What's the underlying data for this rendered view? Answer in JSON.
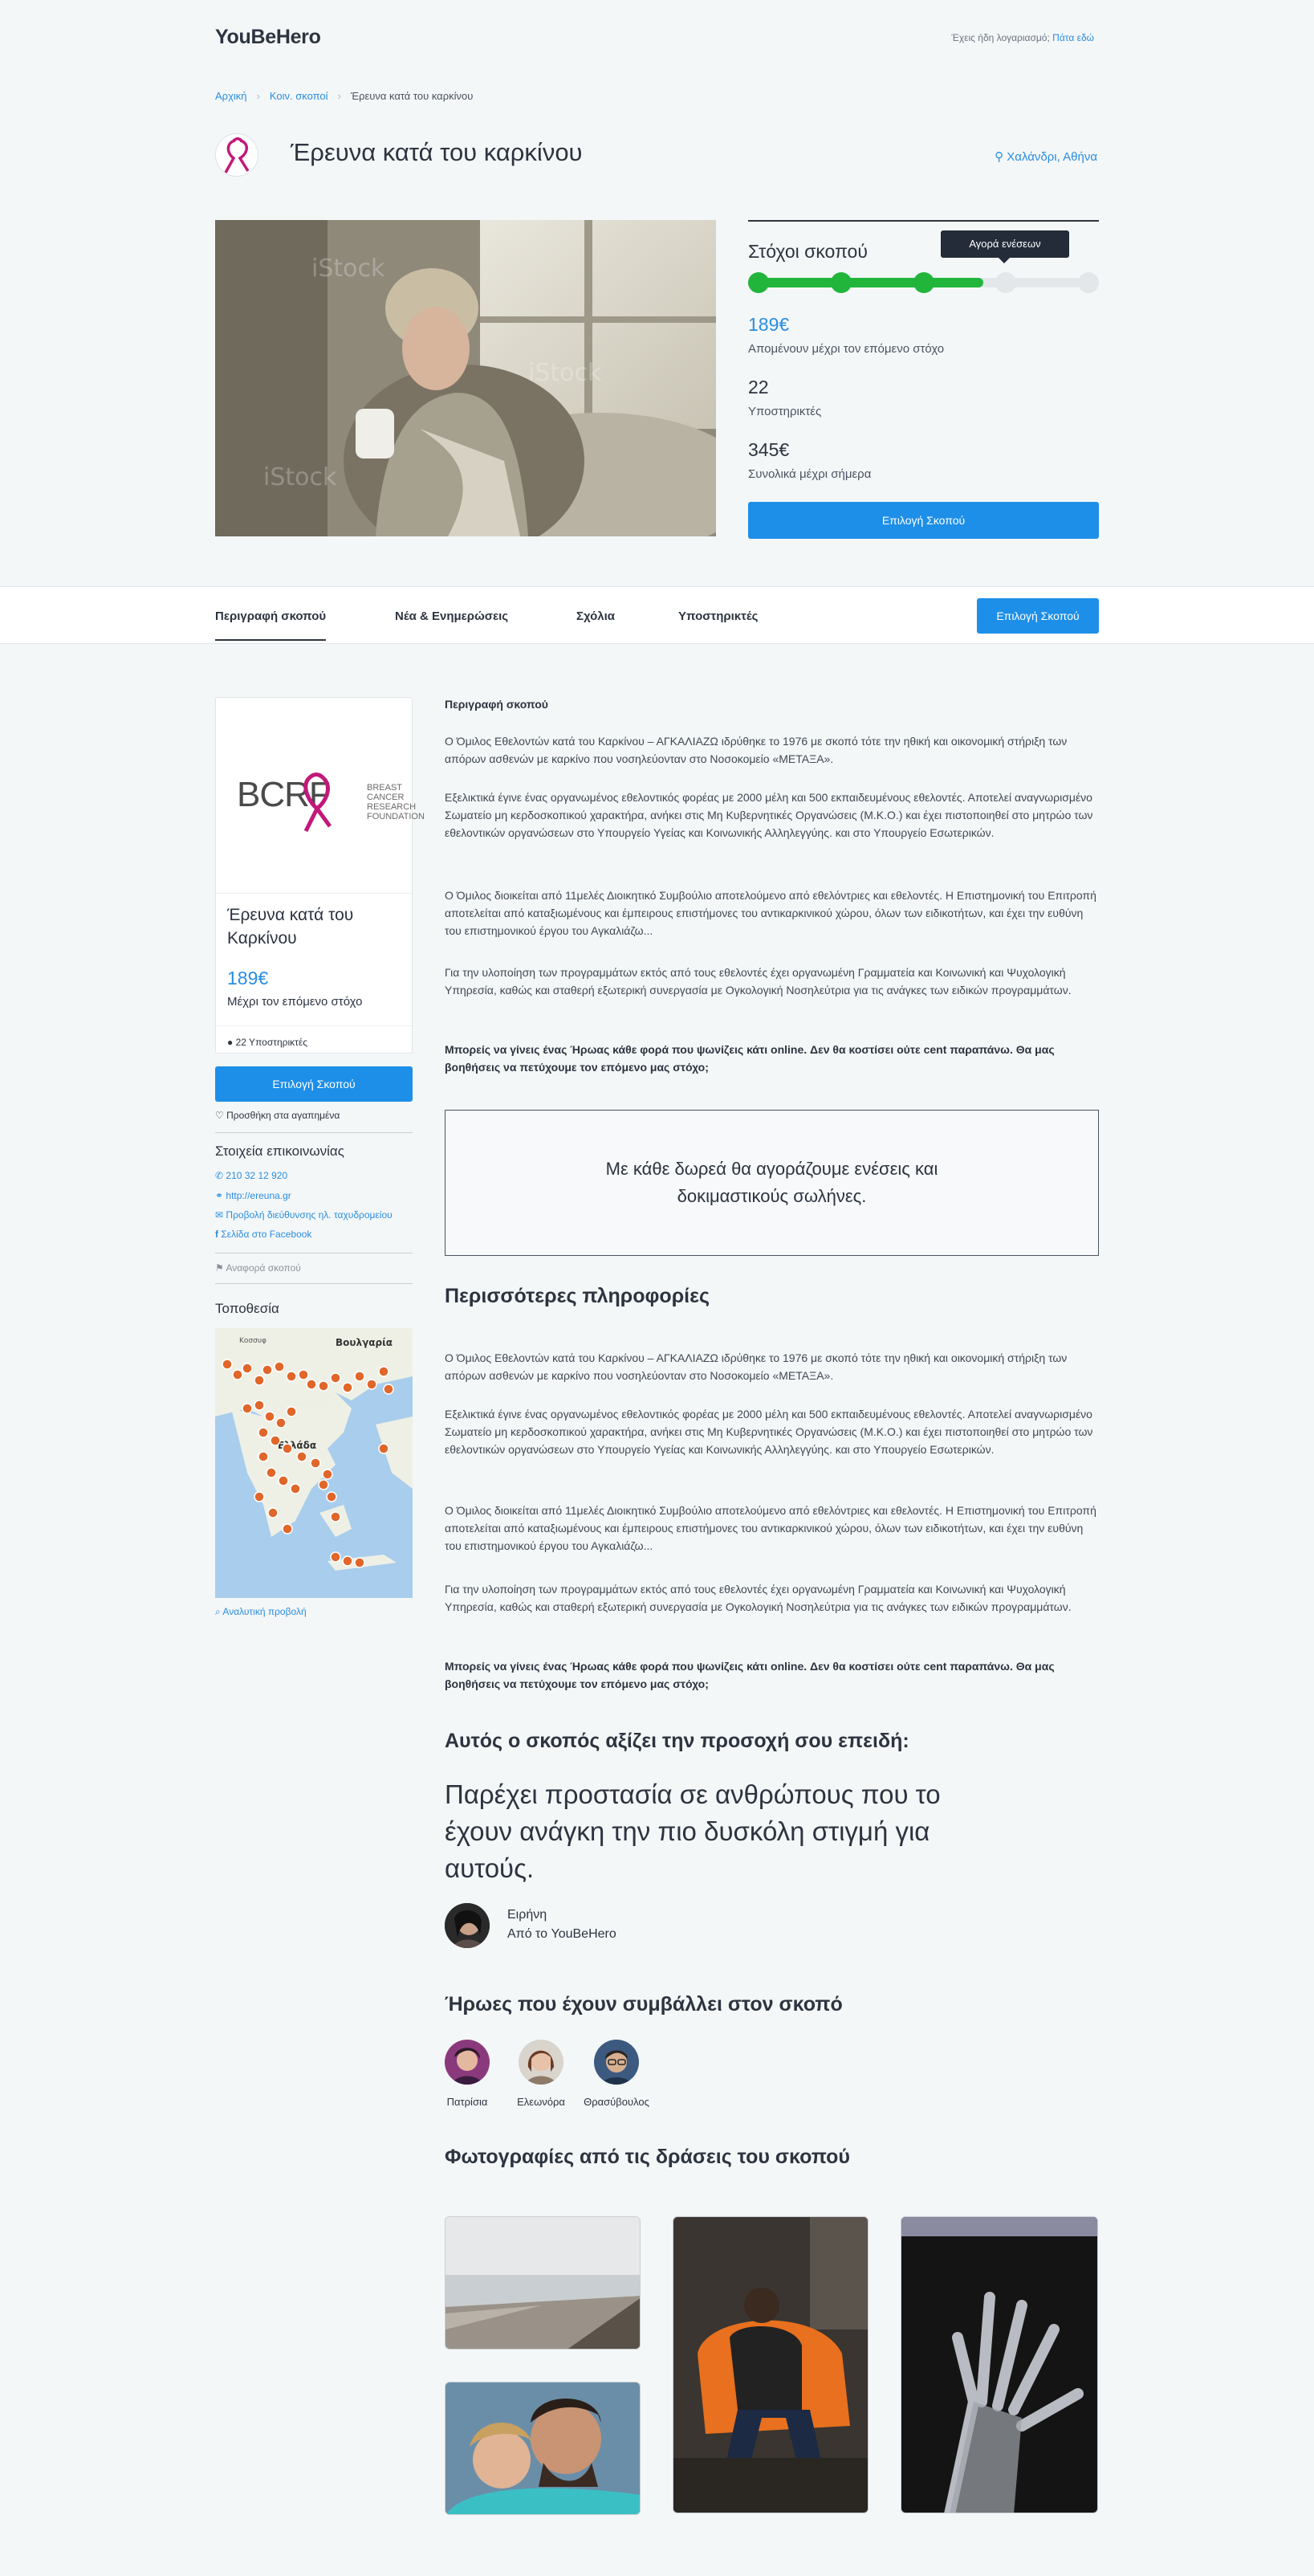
{
  "header": {
    "logo": "YouBeHero",
    "account_prompt": "Έχεις ήδη λογαριασμό;",
    "login_link": "Πάτα εδώ"
  },
  "breadcrumb": [
    "Αρχική",
    "Κοιν. σκοποί",
    "Έρευνα κατά του καρκίνου"
  ],
  "cause": {
    "title": "Έρευνα κατά του καρκίνου",
    "location": "Χαλάνδρι, Αθήνα"
  },
  "goals": {
    "title": "Στόχοι σκοπού",
    "tooltip": "Αγορά ενέσεων",
    "progress": 0.67,
    "milestones": 5,
    "milestones_reached": 3,
    "remaining_value": "189€",
    "remaining_label": "Απομένουν μέχρι τον επόμενο στόχο",
    "supporters_value": "22",
    "supporters_label": "Υποστηρικτές",
    "total_value": "345€",
    "total_label": "Συνολικά μέχρι σήμερα",
    "select_button": "Επιλογή Σκοπού",
    "colors": {
      "filled": "#21b53b",
      "empty": "#e4e7ea"
    }
  },
  "tabs": [
    {
      "label": "Περιγραφή σκοπού",
      "active": true
    },
    {
      "label": "Νέα & Ενημερώσεις",
      "active": false
    },
    {
      "label": "Σχόλια",
      "active": false
    },
    {
      "label": "Υποστηρικτές",
      "active": false
    }
  ],
  "tab_button": "Επιλογή Σκοπού",
  "sidebar": {
    "logo_text": "BCRF",
    "logo_subtext": [
      "BREAST",
      "CANCER",
      "RESEARCH",
      "FOUNDATION"
    ],
    "card_title": "Έρευνα κατά του Καρκίνου",
    "card_amount": "189€",
    "card_label": "Μέχρι τον επόμενο στόχο",
    "card_supporters": "22 Υποστηρικτές",
    "select_button": "Επιλογή Σκοπού",
    "favorite": "Προσθήκη στα αγαπημένα",
    "contact_title": "Στοιχεία επικοινωνίας",
    "contact": {
      "phone": "210 32 12 920",
      "website": "http://ereuna.gr",
      "email": "Προβολή διεύθυνσης ηλ. ταχυδρομείου",
      "facebook": "Σελίδα στο Facebook"
    },
    "report": "Αναφορά σκοπού",
    "location_title": "Τοποθεσία",
    "map_labels": {
      "country1": "Βουλγαρία",
      "country2": "Ελλάδα",
      "city": "Κοσσυφ"
    },
    "map_link": "Αναλυτική προβολή"
  },
  "description": {
    "heading": "Περιγραφή σκοπού",
    "p1": "Ο Όμιλος Εθελοντών κατά του Καρκίνου – ΑΓΚΑΛΙΑΖΩ ιδρύθηκε το 1976 με σκοπό τότε την ηθική και οικονομική στήριξη των απόρων ασθενών με καρκίνο που νοσηλεύονταν στο Νοσοκομείο «ΜΕΤΑΞΑ».",
    "p2": "Εξελικτικά έγινε ένας οργανωμένος εθελοντικός φορέας με 2000 μέλη και 500 εκπαιδευμένους εθελοντές. Αποτελεί αναγνωρισμένο Σωματείο μη κερδοσκοπικού χαρακτήρα, ανήκει στις Μη Κυβερνητικές Οργανώσεις (Μ.Κ.Ο.) και έχει πιστοποιηθεί στο μητρώο των εθελοντικών οργανώσεων στο Υπουργείο Υγείας και Κοινωνικής Αλληλεγγύης. και στο Υπουργείο Εσωτερικών.",
    "p3": "Ο Όμιλος διοικείται από 11μελές Διοικητικό Συμβούλιο αποτελούμενο από εθελόντριες και εθελοντές. Η Επιστημονική του Επιτροπή αποτελείται από καταξιωμένους και έμπειρους επιστήμονες του αντικαρκινικού χώρου, όλων των ειδικοτήτων, και έχει την ευθύνη του επιστημονικού έργου του Αγκαλιάζω...",
    "p4": "Για την υλοποίηση των προγραμμάτων εκτός από τους εθελοντές έχει οργανωμένη Γραμματεία και Κοινωνική και Ψυχολογική Υπηρεσία, καθώς και σταθερή εξωτερική συνεργασία με Ογκολογική Νοσηλεύτρια για τις ανάγκες των ειδικών προγραμμάτων.",
    "cta": "Μπορείς να γίνεις ένας Ήρωας κάθε φορά που ψωνίζεις κάτι online. Δεν θα κοστίσει ούτε cent παραπάνω. Θα μας βοηθήσεις να πετύχουμε τον επόμενο μας στόχο;",
    "boxed": "Με κάθε δωρεά θα αγοράζουμε ενέσεις και δοκιμαστικούς σωλήνες."
  },
  "more_info": {
    "heading": "Περισσότερες πληροφορίες",
    "p1": "Ο Όμιλος Εθελοντών κατά του Καρκίνου – ΑΓΚΑΛΙΑΖΩ ιδρύθηκε το 1976 με σκοπό τότε την ηθική και οικονομική στήριξη των απόρων ασθενών με καρκίνο που νοσηλεύονταν στο Νοσοκομείο «ΜΕΤΑΞΑ».",
    "p2": "Εξελικτικά έγινε ένας οργανωμένος εθελοντικός φορέας με 2000 μέλη και 500 εκπαιδευμένους εθελοντές. Αποτελεί αναγνωρισμένο Σωματείο μη κερδοσκοπικού χαρακτήρα, ανήκει στις Μη Κυβερνητικές Οργανώσεις (Μ.Κ.Ο.) και έχει πιστοποιηθεί στο μητρώο των εθελοντικών οργανώσεων στο Υπουργείο Υγείας και Κοινωνικής Αλληλεγγύης. και στο Υπουργείο Εσωτερικών.",
    "p3": "Ο Όμιλος διοικείται από 11μελές Διοικητικό Συμβούλιο αποτελούμενο από εθελόντριες και εθελοντές. Η Επιστημονική του Επιτροπή αποτελείται από καταξιωμένους και έμπειρους επιστήμονες του αντικαρκινικού χώρου, όλων των ειδικοτήτων, και έχει την ευθύνη του επιστημονικού έργου του Αγκαλιάζω...",
    "p4": "Για την υλοποίηση των προγραμμάτων εκτός από τους εθελοντές έχει οργανωμένη Γραμματεία και Κοινωνική και Ψυχολογική Υπηρεσία, καθώς και σταθερή εξωτερική συνεργασία με Ογκολογική Νοσηλεύτρια για τις ανάγκες των ειδικών προγραμμάτων.",
    "cta": "Μπορείς να γίνεις ένας Ήρωας κάθε φορά που ψωνίζεις κάτι online. Δεν θα κοστίσει ούτε cent παραπάνω. Θα μας βοηθήσεις να πετύχουμε τον επόμενο μας στόχο;"
  },
  "attention": {
    "heading": "Αυτός ο σκοπός αξίζει την προσοχή σου επειδή:",
    "quote": "Παρέχει προστασία σε ανθρώπους που το έχουν ανάγκη την πιο δυσκόλη στιγμή για αυτούς.",
    "author_name": "Ειρήνη",
    "author_org": "Από το YouBeHero"
  },
  "heroes": {
    "heading": "Ήρωες που έχουν συμβάλλει στον σκοπό",
    "people": [
      "Πατρίσια",
      "Ελεωνόρα",
      "Θρασύβουλος"
    ]
  },
  "photos": {
    "heading": "Φωτογραφίες από τις δράσεις του σκοπού"
  }
}
